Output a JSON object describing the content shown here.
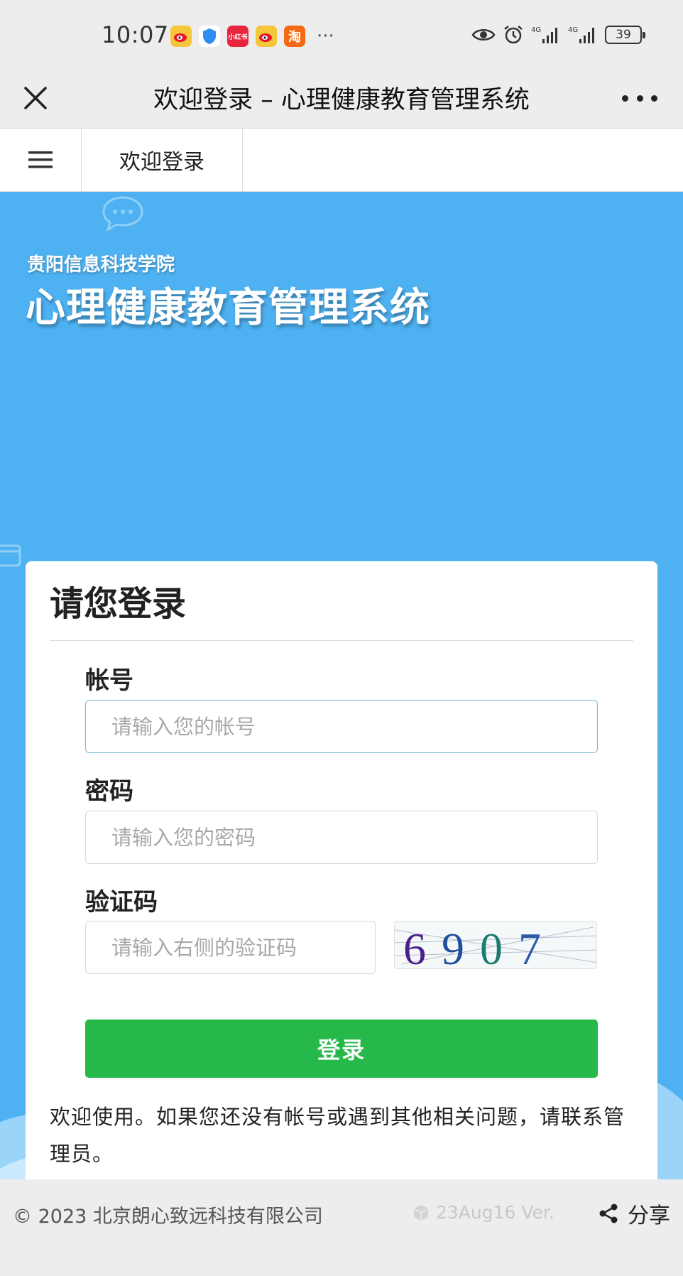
{
  "status_bar": {
    "time": "10:07",
    "battery": "39",
    "net1": "4G",
    "net2": "4G"
  },
  "titlebar": {
    "title": "欢迎登录 – 心理健康教育管理系统"
  },
  "tabbar": {
    "current_tab": "欢迎登录"
  },
  "header": {
    "school": "贵阳信息科技学院",
    "system_name": "心理健康教育管理系统"
  },
  "login": {
    "title": "请您登录",
    "account_label": "帐号",
    "account_placeholder": "请输入您的帐号",
    "password_label": "密码",
    "password_placeholder": "请输入您的密码",
    "captcha_label": "验证码",
    "captcha_placeholder": "请输入右侧的验证码",
    "captcha_text": "6907",
    "submit": "登录",
    "welcome_text": "欢迎使用。如果您还没有帐号或遇到其他相关问题，请联系管理员。"
  },
  "footer": {
    "copyright": "© 2023 北京朗心致远科技有限公司",
    "version": "23Aug16 Ver.",
    "share": "分享"
  },
  "colors": {
    "background_blue": "#4eb1f1",
    "login_green": "#26b94a",
    "card": "#ffffff"
  }
}
